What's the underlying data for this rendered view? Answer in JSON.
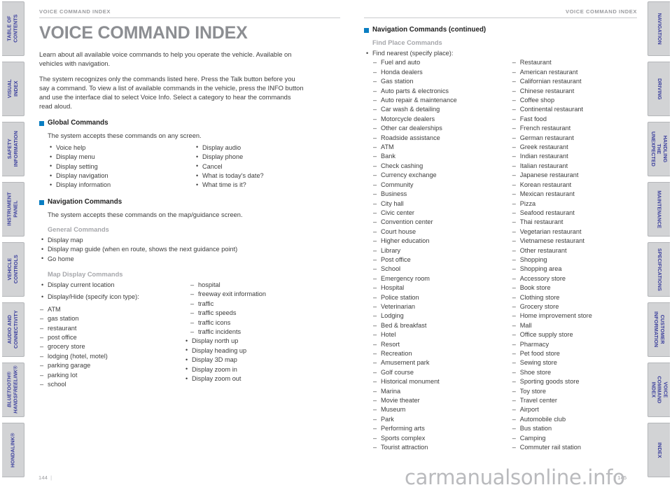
{
  "left_rail": {
    "tabs": [
      {
        "label": "TABLE OF CONTENTS",
        "italic": false
      },
      {
        "label": "VISUAL INDEX",
        "italic": false
      },
      {
        "label": "SAFETY\nINFORMATION",
        "italic": false
      },
      {
        "label": "INSTRUMENT PANEL",
        "italic": false
      },
      {
        "label": "VEHICLE\nCONTROLS",
        "italic": false
      },
      {
        "label": "AUDIO AND\nCONNECTIVITY",
        "italic": false
      },
      {
        "label": "BLUETOOTH®\nHANDSFREELINK®",
        "italic": true
      },
      {
        "label": "HONDALINK®",
        "italic": false
      }
    ]
  },
  "right_rail": {
    "tabs": [
      {
        "label": "NAVIGATION"
      },
      {
        "label": "DRIVING"
      },
      {
        "label": "HANDLING THE\nUNEXPECTED"
      },
      {
        "label": "MAINTENANCE"
      },
      {
        "label": "SPECIFICATIONS"
      },
      {
        "label": "CUSTOMER\nINFORMATION"
      },
      {
        "label": "VOICE COMMAND\nINDEX"
      },
      {
        "label": "INDEX"
      }
    ]
  },
  "left_page": {
    "running_head": "VOICE COMMAND INDEX",
    "title": "VOICE COMMAND INDEX",
    "intro1": "Learn about all available voice commands to help you operate the vehicle. Available on vehicles with navigation.",
    "intro2": "The system recognizes only the commands listed here. Press the Talk button before you say a command. To view a list of available commands in the vehicle, press the INFO button and use the interface dial to select Voice Info. Select a category to hear the commands read aloud.",
    "global": {
      "heading": "Global Commands",
      "note": "The system accepts these commands on any screen.",
      "col1": [
        "Voice help",
        "Display menu",
        "Display setting",
        "Display navigation",
        "Display information"
      ],
      "col2": [
        "Display audio",
        "Display phone",
        "Cancel",
        "What is today’s date?",
        "What time is it?"
      ]
    },
    "navigation": {
      "heading": "Navigation Commands",
      "note": "The system accepts these commands on the map/guidance screen.",
      "general": {
        "sub_head": "General Commands",
        "items": [
          "Display map",
          "Display map guide (when en route, shows the next guidance point)",
          "Go home"
        ]
      },
      "map_display": {
        "sub_head": "Map Display Commands",
        "bullet1": "Display current location",
        "bullet2": "Display/Hide (specify icon type):",
        "icon_types_col1": [
          "ATM",
          "gas station",
          "restaurant",
          "post office",
          "grocery store",
          "lodging (hotel, motel)",
          "parking garage",
          "parking lot",
          "school"
        ],
        "icon_types_col2": [
          "hospital",
          "freeway exit information",
          "traffic",
          "traffic speeds",
          "traffic icons",
          "traffic incidents"
        ],
        "bullets_col2": [
          "Display north up",
          "Display heading up",
          "Display 3D map",
          "Display zoom in",
          "Display zoom out"
        ]
      }
    },
    "folio": "144"
  },
  "right_page": {
    "running_head": "VOICE COMMAND INDEX",
    "navigation_continued": {
      "heading": "Navigation Commands (continued)",
      "sub_head": "Find Place Commands",
      "bullet": "Find nearest (specify place):",
      "places_col1": [
        "Fuel and auto",
        "Honda dealers",
        "Gas station",
        "Auto parts & electronics",
        "Auto repair & maintenance",
        "Car wash & detailing",
        "Motorcycle dealers",
        "Other car dealerships",
        "Roadside assistance",
        "ATM",
        "Bank",
        "Check cashing",
        "Currency exchange",
        "Community",
        "Business",
        "City hall",
        "Civic center",
        "Convention center",
        "Court house",
        "Higher education",
        "Library",
        "Post office",
        "School",
        "Emergency room",
        "Hospital",
        "Police station",
        "Veterinarian",
        "Lodging",
        "Bed & breakfast",
        "Hotel",
        "Resort",
        "Recreation",
        "Amusement park",
        "Golf course",
        "Historical monument",
        "Marina",
        "Movie theater",
        "Museum",
        "Park",
        "Performing arts",
        "Sports complex",
        "Tourist attraction"
      ],
      "places_col2": [
        "Restaurant",
        "American restaurant",
        "Californian restaurant",
        "Chinese restaurant",
        "Coffee shop",
        "Continental restaurant",
        "Fast food",
        "French restaurant",
        "German restaurant",
        "Greek restaurant",
        "Indian restaurant",
        "Italian restaurant",
        "Japanese restaurant",
        "Korean restaurant",
        "Mexican restaurant",
        "Pizza",
        "Seafood restaurant",
        "Thai restaurant",
        "Vegetarian restaurant",
        "Vietnamese restaurant",
        "Other restaurant",
        "Shopping",
        "Shopping area",
        "Accessory store",
        "Book store",
        "Clothing store",
        "Grocery store",
        "Home improvement store",
        "Mall",
        "Office supply store",
        "Pharmacy",
        "Pet food store",
        "Sewing store",
        "Shoe store",
        "Sporting goods store",
        "Toy store",
        "Travel center",
        "Airport",
        "Automobile club",
        "Bus station",
        "Camping",
        "Commuter rail station"
      ]
    },
    "folio": "145"
  },
  "watermark": "carmanualsonline.info",
  "colors": {
    "accent_blue": "#0a7ec2",
    "tab_text_blue": "#3b3f9c",
    "tab_fill": "#d2d3d5",
    "title_gray": "#8c8e92",
    "body_gray": "#3d3d3d"
  }
}
